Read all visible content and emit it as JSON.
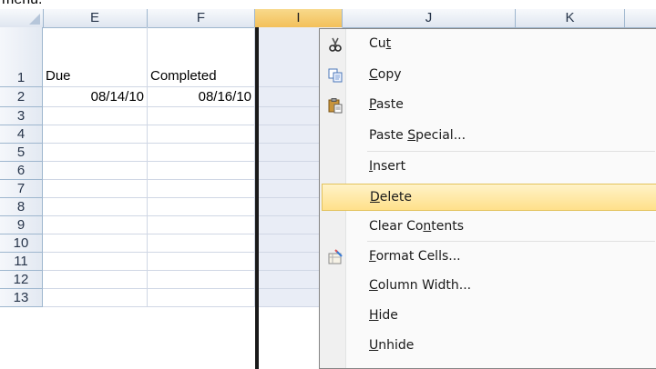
{
  "top_fragment": "menu.",
  "columns": [
    {
      "id": "E",
      "label": "E"
    },
    {
      "id": "F",
      "label": "F"
    },
    {
      "id": "I",
      "label": "I"
    },
    {
      "id": "J",
      "label": "J"
    },
    {
      "id": "K",
      "label": "K"
    }
  ],
  "rows": [
    "1",
    "2",
    "3",
    "4",
    "5",
    "6",
    "7",
    "8",
    "9",
    "10",
    "11",
    "12",
    "13"
  ],
  "cells": {
    "E1": "Due",
    "F1": "Completed",
    "E2": "08/14/10",
    "F2": "08/16/10"
  },
  "context_menu": {
    "items": [
      {
        "key": "cut",
        "pre": "Cu",
        "ul": "t",
        "post": "",
        "icon": "scissors-icon"
      },
      {
        "key": "copy",
        "pre": "",
        "ul": "C",
        "post": "opy",
        "icon": "copy-icon"
      },
      {
        "key": "paste",
        "pre": "",
        "ul": "P",
        "post": "aste",
        "icon": "paste-icon"
      },
      {
        "key": "paste_special",
        "pre": "Paste ",
        "ul": "S",
        "post": "pecial...",
        "icon": ""
      },
      {
        "key": "insert",
        "pre": "",
        "ul": "I",
        "post": "nsert",
        "icon": ""
      },
      {
        "key": "delete",
        "pre": "",
        "ul": "D",
        "post": "elete",
        "icon": "",
        "highlighted": true
      },
      {
        "key": "clear_contents",
        "pre": "Clear Co",
        "ul": "n",
        "post": "tents",
        "icon": ""
      },
      {
        "key": "format_cells",
        "pre": "",
        "ul": "F",
        "post": "ormat Cells...",
        "icon": "format-cells-icon"
      },
      {
        "key": "column_width",
        "pre": "",
        "ul": "C",
        "post": "olumn Width...",
        "icon": ""
      },
      {
        "key": "hide",
        "pre": "",
        "ul": "H",
        "post": "ide",
        "icon": ""
      },
      {
        "key": "unhide",
        "pre": "",
        "ul": "U",
        "post": "nhide",
        "icon": ""
      }
    ]
  },
  "colors": {
    "highlight": "#ffe08a",
    "header_selected": "#f3c05a",
    "grid": "#d0d7e5"
  }
}
